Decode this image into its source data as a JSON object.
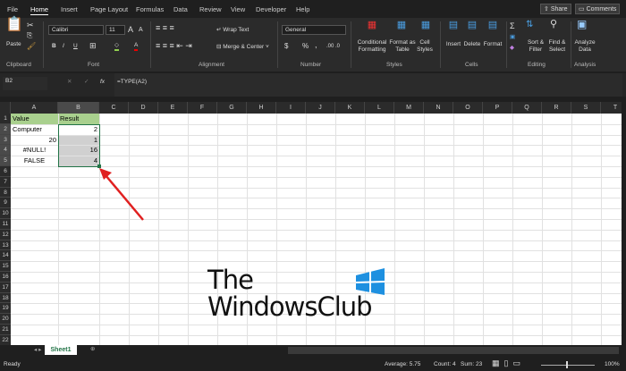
{
  "ribbon_tabs": [
    "File",
    "Home",
    "Insert",
    "Page Layout",
    "Formulas",
    "Data",
    "Review",
    "View",
    "Developer",
    "Help"
  ],
  "active_tab": "Home",
  "share_label": "Share",
  "comments_label": "Comments",
  "clipboard": {
    "paste": "Paste",
    "group": "Clipboard"
  },
  "font": {
    "name": "Calibri",
    "size": "11",
    "group": "Font",
    "bold": "B",
    "italic": "I",
    "underline": "U"
  },
  "alignment": {
    "wrap": "Wrap Text",
    "merge": "Merge & Center",
    "group": "Alignment"
  },
  "number": {
    "format": "General",
    "currency": "$",
    "percent": "%",
    "comma": ",",
    "group": "Number"
  },
  "styles": {
    "conditional": "Conditional Formatting",
    "format_table": "Format as Table",
    "cell_styles": "Cell Styles",
    "group": "Styles"
  },
  "cells": {
    "insert": "Insert",
    "delete": "Delete",
    "format": "Format",
    "group": "Cells"
  },
  "editing": {
    "sort": "Sort & Filter",
    "find": "Find & Select",
    "group": "Editing",
    "sum": "Σ"
  },
  "analysis": {
    "analyze": "Analyze Data",
    "group": "Analysis"
  },
  "formula_bar": {
    "name_box": "B2",
    "formula": "=TYPE(A2)",
    "fx": "fx"
  },
  "columns": [
    "A",
    "B",
    "C",
    "D",
    "E",
    "F",
    "G",
    "H",
    "I",
    "J",
    "K",
    "L",
    "M",
    "N",
    "O",
    "P",
    "Q",
    "R",
    "S",
    "T"
  ],
  "rows": [
    "1",
    "2",
    "3",
    "4",
    "5",
    "6",
    "7",
    "8",
    "9",
    "10",
    "11",
    "12",
    "13",
    "14",
    "15",
    "16",
    "17",
    "18",
    "19",
    "20",
    "21",
    "22"
  ],
  "cells_data": {
    "A1": "Value",
    "B1": "Result",
    "A2": "Computer",
    "B2": "2",
    "A3": "20",
    "B3": "1",
    "A4": "#NULL!",
    "B4": "16",
    "A5": "FALSE",
    "B5": "4"
  },
  "header_fill": "#a9d08e",
  "selection_fill": "#d0d0d0",
  "accent": "#217346",
  "watermark": {
    "line1": "The",
    "line2": "WindowsClub"
  },
  "sheet_tab": "Sheet1",
  "status": {
    "ready": "Ready",
    "average": "Average: 5.75",
    "count": "Count: 4",
    "sum": "Sum: 23",
    "zoom": "100%"
  }
}
